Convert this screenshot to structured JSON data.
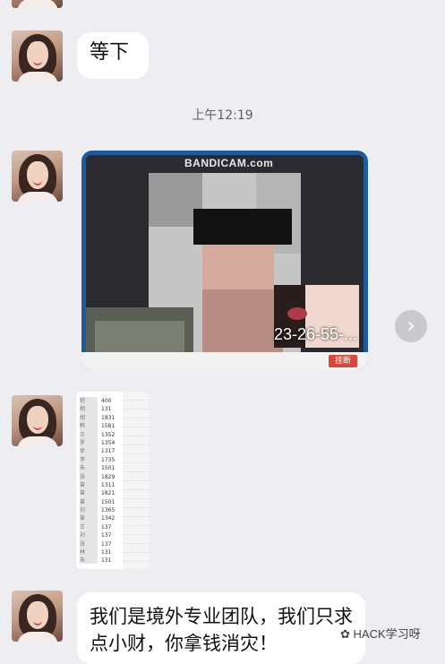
{
  "messages": {
    "m1": {
      "text": "等下"
    },
    "time": "上午12:19",
    "m2": {
      "watermark": "BANDICAM.com",
      "timestamp": "23-26-55-...",
      "button": "挂断"
    },
    "m3": {
      "names": [
        "何",
        "胡",
        "胡",
        "韩",
        "王",
        "罗",
        "徐",
        "李",
        "朱",
        "张",
        "曾",
        "曾",
        "曾",
        "刘",
        "曾",
        "王",
        "刘",
        "张",
        "林",
        "朱"
      ],
      "numbers": [
        "400",
        "131",
        "1831",
        "1581",
        "1352",
        "1354",
        "1317",
        "1735",
        "1501",
        "1829",
        "1311",
        "1821",
        "1501",
        "1365",
        "1342",
        "137",
        "137",
        "137",
        "131",
        "131"
      ]
    },
    "m4": {
      "text": "我们是境外专业团队，我们只求点小财，你拿钱消灾！"
    }
  },
  "watermark": "HACK学习呀",
  "nav_arrow": "›"
}
